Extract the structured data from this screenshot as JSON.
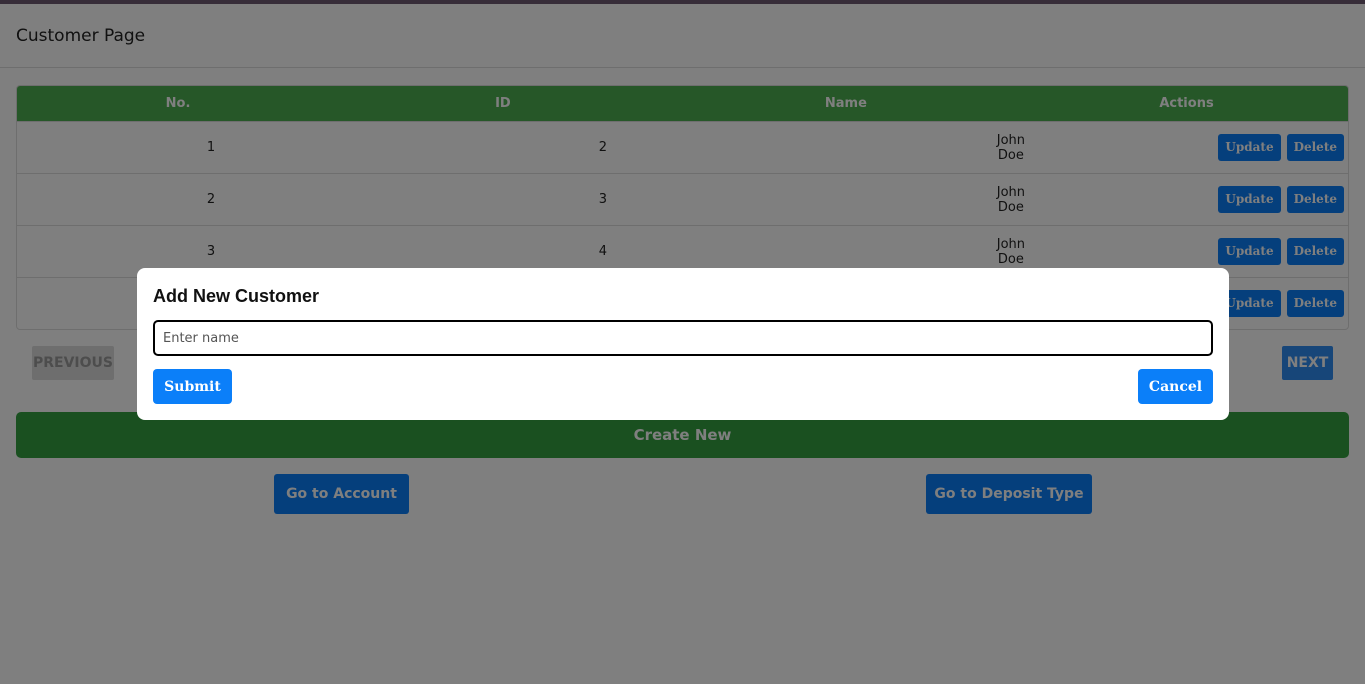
{
  "page": {
    "title": "Customer Page"
  },
  "table": {
    "headers": [
      "No.",
      "ID",
      "Name",
      "Actions"
    ],
    "rows": [
      {
        "no": "1",
        "id": "2",
        "name": "John Doe"
      },
      {
        "no": "2",
        "id": "3",
        "name": "John Doe"
      },
      {
        "no": "3",
        "id": "4",
        "name": "John Doe"
      },
      {
        "no": "",
        "id": "",
        "name": ""
      }
    ],
    "update_label": "Update",
    "delete_label": "Delete"
  },
  "pager": {
    "previous_label": "PREVIOUS",
    "next_label": "NEXT"
  },
  "actions": {
    "create_label": "Create New",
    "account_label": "Go to Account",
    "deposit_label": "Go to Deposit Type"
  },
  "modal": {
    "title": "Add New Customer",
    "input_placeholder": "Enter name",
    "input_value": "",
    "submit_label": "Submit",
    "cancel_label": "Cancel"
  },
  "colors": {
    "header_green": "#4caf50",
    "create_green": "#34a040",
    "button_blue": "#0b7ff9",
    "overlay": "rgba(0,0,0,0.5)"
  }
}
